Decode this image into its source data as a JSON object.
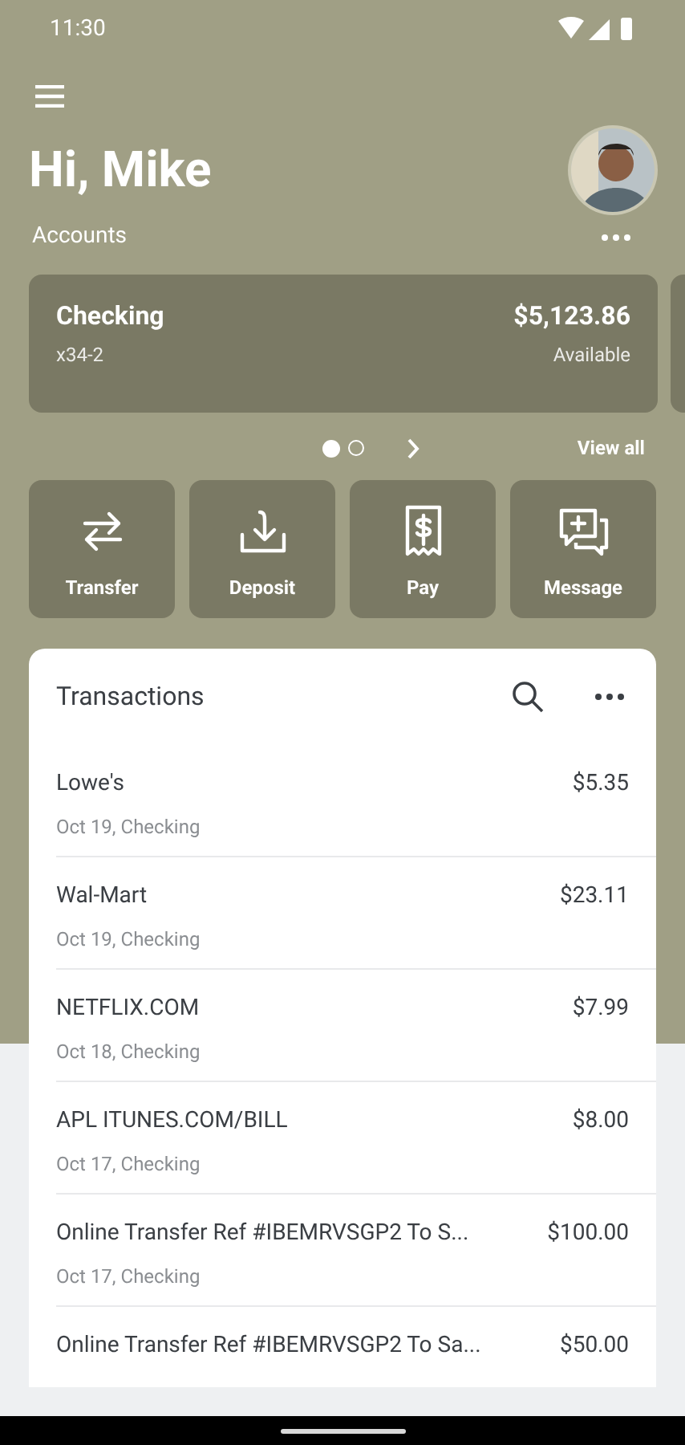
{
  "status_bar": {
    "time": "11:30"
  },
  "greeting": "Hi, Mike",
  "accounts": {
    "title": "Accounts",
    "cards": [
      {
        "name": "Checking",
        "number": "x34-2",
        "balance": "$5,123.86",
        "balance_label": "Available"
      }
    ],
    "pager": [
      {
        "selected": true
      },
      {
        "selected": false
      }
    ],
    "view_all": "View all"
  },
  "actions": [
    {
      "kind": "transfer",
      "label": "Transfer"
    },
    {
      "kind": "deposit",
      "label": "Deposit"
    },
    {
      "kind": "pay",
      "label": "Pay"
    },
    {
      "kind": "message",
      "label": "Message"
    }
  ],
  "transactions": {
    "title": "Transactions",
    "rows": [
      {
        "name": "Lowe's",
        "detail": "Oct 19, Checking",
        "amount": "$5.35"
      },
      {
        "name": "Wal-Mart",
        "detail": "Oct 19, Checking",
        "amount": "$23.11"
      },
      {
        "name": "NETFLIX.COM",
        "detail": "Oct 18, Checking",
        "amount": "$7.99"
      },
      {
        "name": "APL ITUNES.COM/BILL",
        "detail": "Oct 17, Checking",
        "amount": "$8.00"
      },
      {
        "name": "Online Transfer Ref #IBEMRVSGP2 To S...",
        "detail": "Oct 17, Checking",
        "amount": "$100.00"
      },
      {
        "name": "Online Transfer Ref #IBEMRVSGP2 To Sa...",
        "amount": "$50.00"
      }
    ]
  }
}
